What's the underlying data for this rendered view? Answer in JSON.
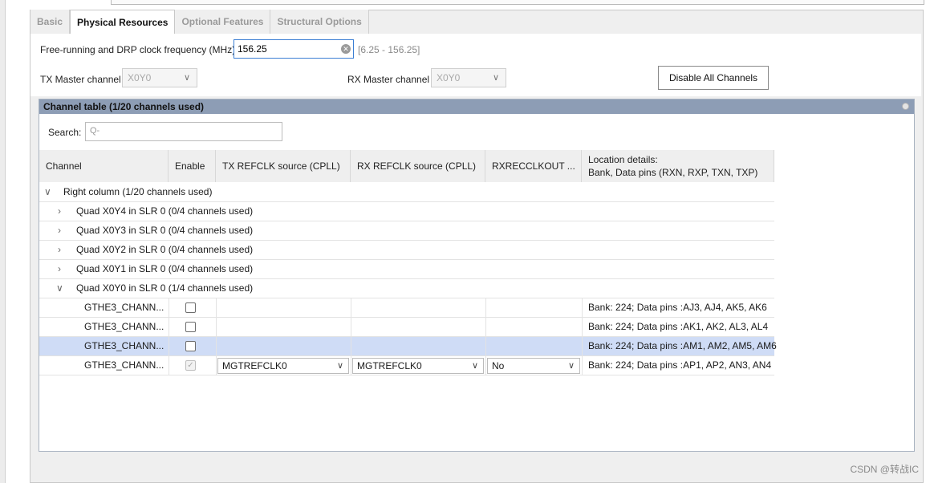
{
  "tabs": [
    "Basic",
    "Physical Resources",
    "Optional Features",
    "Structural Options"
  ],
  "form": {
    "freq_label": "Free-running and DRP clock frequency (MHz)",
    "freq_value": "156.25",
    "freq_range": "[6.25 - 156.25]",
    "tx_master_label": "TX Master channel",
    "tx_master_value": "X0Y0",
    "rx_master_label": "RX Master channel",
    "rx_master_value": "X0Y0",
    "disable_button": "Disable All Channels"
  },
  "table_panel": {
    "title": "Channel table (1/20 channels used)",
    "search_label": "Search:",
    "search_placeholder": "Q-"
  },
  "columns": {
    "channel": "Channel",
    "enable": "Enable",
    "tx_refclk": "TX REFCLK source (CPLL)",
    "rx_refclk": "RX REFCLK source (CPLL)",
    "rxrecclk": "RXRECCLKOUT ...",
    "location_1": "Location details:",
    "location_2": "Bank, Data pins (RXN, RXP, TXN, TXP)"
  },
  "tree": {
    "root": "Right column (1/20 channels used)",
    "quads": [
      "Quad X0Y4 in SLR 0 (0/4 channels used)",
      "Quad X0Y3 in SLR 0 (0/4 channels used)",
      "Quad X0Y2 in SLR 0 (0/4 channels used)",
      "Quad X0Y1 in SLR 0 (0/4 channels used)",
      "Quad X0Y0 in SLR 0 (1/4 channels used)"
    ],
    "channels": [
      {
        "name": "GTHE3_CHANN...",
        "location": "Bank: 224; Data pins :AJ3, AJ4, AK5, AK6"
      },
      {
        "name": "GTHE3_CHANN...",
        "location": "Bank: 224; Data pins :AK1, AK2, AL3, AL4"
      },
      {
        "name": "GTHE3_CHANN...",
        "location": "Bank: 224; Data pins :AM1, AM2, AM5, AM6"
      },
      {
        "name": "GTHE3_CHANN...",
        "tx_refclk": "MGTREFCLK0",
        "rx_refclk": "MGTREFCLK0",
        "rxrecclk": "No",
        "location": "Bank: 224; Data pins :AP1, AP2, AN3, AN4"
      }
    ]
  },
  "watermark": "CSDN @转战IC",
  "colors": {
    "header_bar": "#8d9db5",
    "selected_row": "#cfdcf6",
    "focus_border": "#3c7fd4"
  }
}
